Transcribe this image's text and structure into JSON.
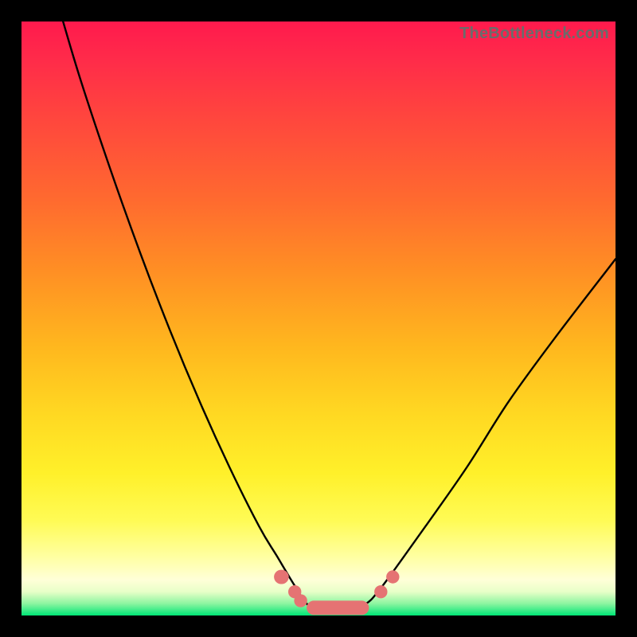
{
  "watermark": "TheBottleneck.com",
  "chart_data": {
    "type": "line",
    "title": "",
    "xlabel": "",
    "ylabel": "",
    "xlim": [
      0,
      100
    ],
    "ylim": [
      0,
      100
    ],
    "legend": false,
    "grid": false,
    "series": [
      {
        "name": "bottleneck-curve",
        "x": [
          7,
          10,
          15,
          20,
          25,
          30,
          35,
          40,
          43,
          46,
          48,
          50,
          52,
          55,
          58,
          60,
          63,
          68,
          75,
          82,
          90,
          100
        ],
        "values": [
          100,
          90,
          75,
          61,
          48,
          36,
          25,
          15,
          10,
          5,
          2,
          1,
          1,
          1,
          2,
          4,
          8,
          15,
          25,
          36,
          47,
          60
        ]
      }
    ],
    "markers": [
      {
        "shape": "pill",
        "x0": 42.5,
        "x1": 45.0,
        "y": 6.5,
        "color": "#e57373"
      },
      {
        "shape": "circle",
        "x": 46.0,
        "y": 4.0,
        "r": 1.1,
        "color": "#e57373"
      },
      {
        "shape": "circle",
        "x": 47.0,
        "y": 2.5,
        "r": 1.1,
        "color": "#e57373"
      },
      {
        "shape": "pill",
        "x0": 48.0,
        "x1": 58.5,
        "y": 1.3,
        "color": "#e57373"
      },
      {
        "shape": "circle",
        "x": 60.5,
        "y": 4.0,
        "r": 1.1,
        "color": "#e57373"
      },
      {
        "shape": "circle",
        "x": 62.5,
        "y": 6.5,
        "r": 1.1,
        "color": "#e57373"
      }
    ],
    "background_gradient": {
      "direction": "top-to-bottom",
      "stops": [
        {
          "pos": 0,
          "color": "#ff1a4d"
        },
        {
          "pos": 50,
          "color": "#ffa020"
        },
        {
          "pos": 80,
          "color": "#fff02a"
        },
        {
          "pos": 95,
          "color": "#ffffd0"
        },
        {
          "pos": 100,
          "color": "#00e676"
        }
      ]
    }
  }
}
